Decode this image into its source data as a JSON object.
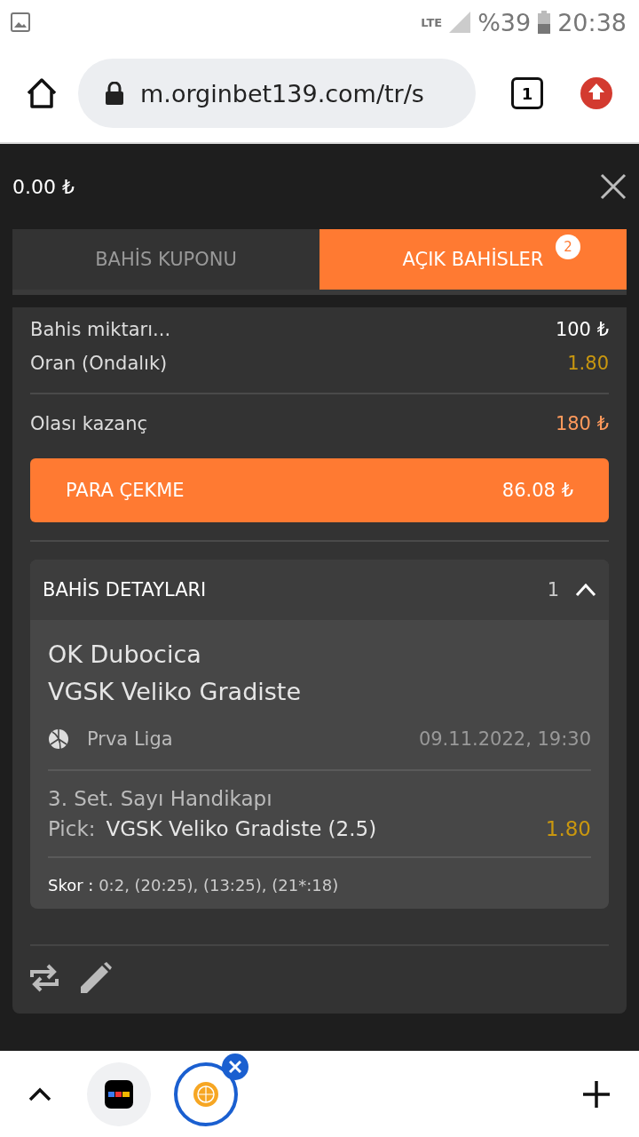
{
  "status_bar": {
    "network": "LTE",
    "battery": "%39",
    "time": "20:38"
  },
  "browser": {
    "url": "m.orginbet139.com/tr/s",
    "tab_count": "1"
  },
  "header": {
    "balance": "0.00 ₺"
  },
  "tabs": [
    {
      "label": "BAHİS KUPONU",
      "selected": false
    },
    {
      "label": "AÇIK BAHİSLER",
      "selected": true,
      "badge": "2"
    }
  ],
  "summary": [
    {
      "label": "Bahis miktarı...",
      "value": "100 ₺",
      "kind": "plain"
    },
    {
      "label": "Oran (Ondalık)",
      "value": "1.80",
      "kind": "odds"
    },
    {
      "label": "Olası kazanç",
      "value": "180 ₺",
      "kind": "win"
    }
  ],
  "cashout": {
    "label": "PARA ÇEKME",
    "amount": "86.08 ₺"
  },
  "details": {
    "title": "BAHİS DETAYLARI",
    "count": "1",
    "expanded": true,
    "teams": [
      "OK Dubocica",
      "VGSK Veliko Gradiste"
    ],
    "league": "Prva Liga",
    "datetime": "09.11.2022, 19:30",
    "market": "3. Set. Sayı Handikapı",
    "pick_label": "Pick:",
    "pick": "VGSK Veliko Gradiste (2.5)",
    "odds": "1.80",
    "score_label": "Skor :",
    "score": "0:2, (20:25), (13:25), (21*:18)"
  }
}
